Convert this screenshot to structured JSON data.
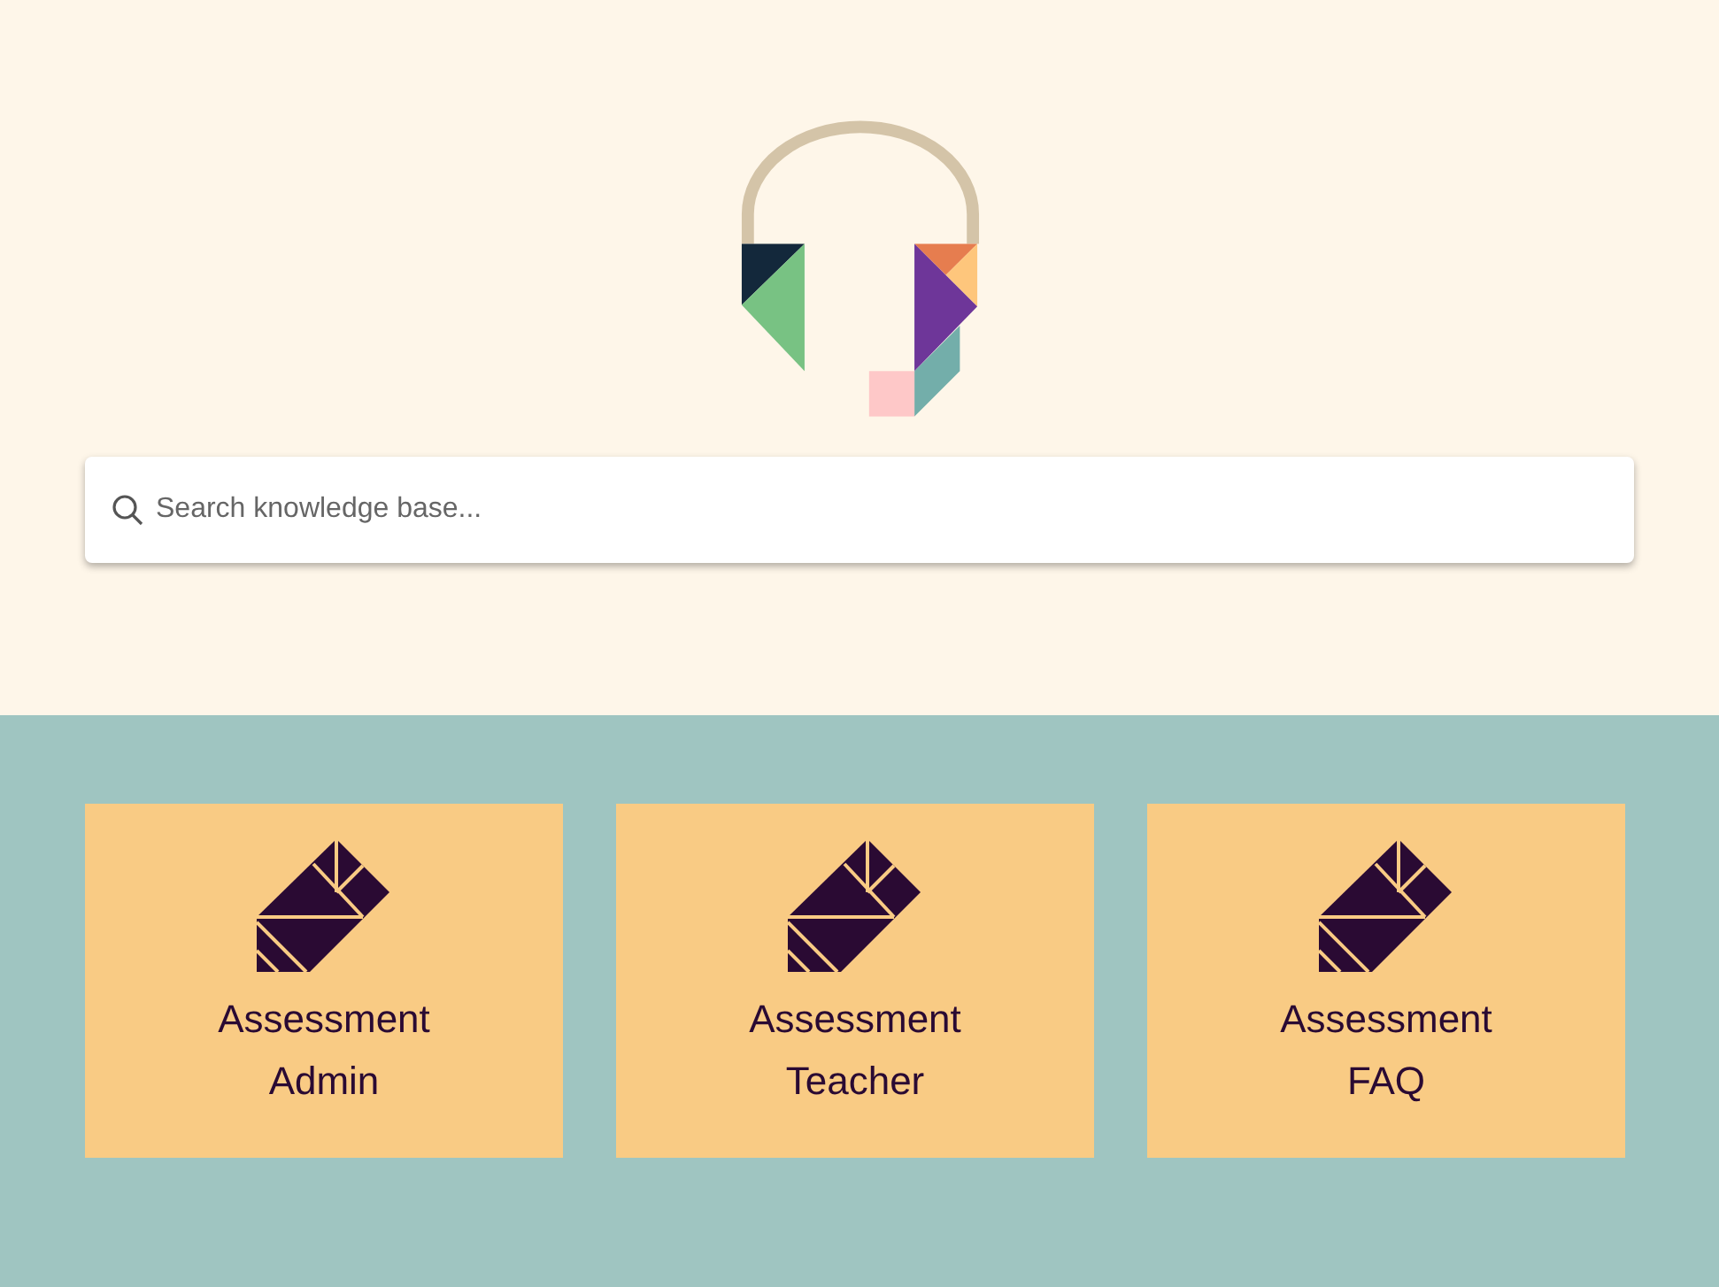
{
  "search": {
    "placeholder": "Search knowledge base..."
  },
  "categories": [
    {
      "title": "Assessment Admin"
    },
    {
      "title": "Assessment Teacher"
    },
    {
      "title": "Assessment FAQ"
    }
  ]
}
